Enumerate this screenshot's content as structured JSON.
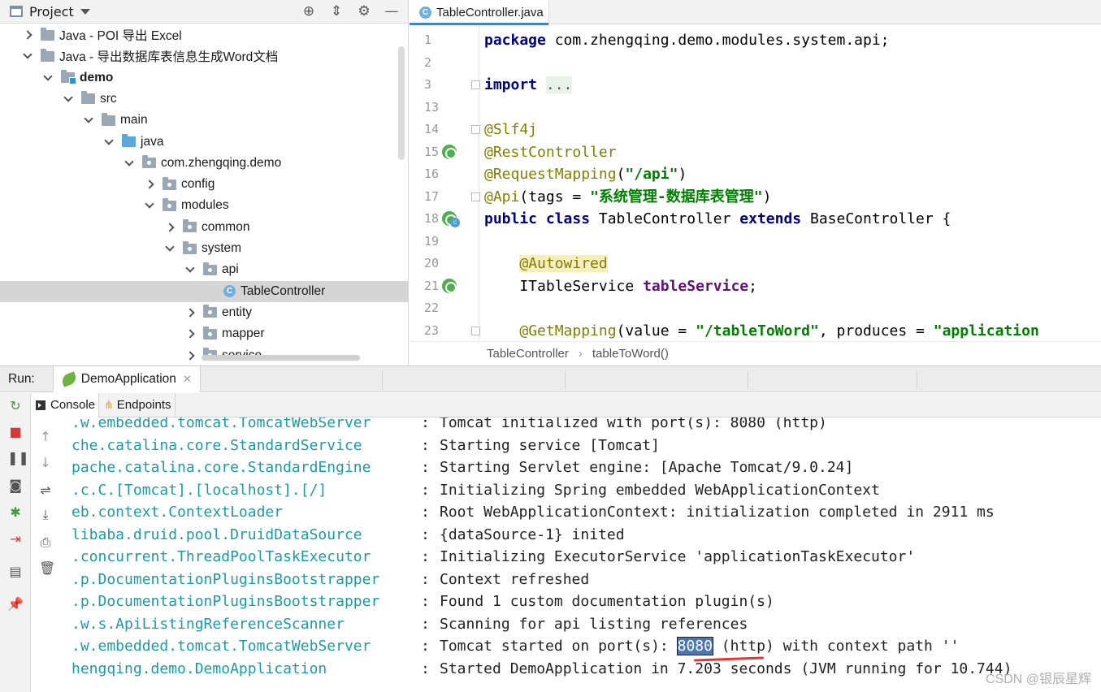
{
  "project": {
    "title": "Project",
    "tree": [
      {
        "label": "Java - POI 导出 Excel",
        "depth": 0,
        "chevron": "right",
        "icon": "folder",
        "bold": false,
        "selected": false
      },
      {
        "label": "Java - 导出数据库表信息生成Word文档",
        "depth": 0,
        "chevron": "down",
        "icon": "folder",
        "bold": false,
        "selected": false
      },
      {
        "label": "demo",
        "depth": 1,
        "chevron": "down",
        "icon": "module-folder",
        "bold": true,
        "selected": false
      },
      {
        "label": "src",
        "depth": 2,
        "chevron": "down",
        "icon": "folder",
        "bold": false,
        "selected": false
      },
      {
        "label": "main",
        "depth": 3,
        "chevron": "down",
        "icon": "folder",
        "bold": false,
        "selected": false
      },
      {
        "label": "java",
        "depth": 4,
        "chevron": "down",
        "icon": "source-folder",
        "bold": false,
        "selected": false
      },
      {
        "label": "com.zhengqing.demo",
        "depth": 5,
        "chevron": "down",
        "icon": "package",
        "bold": false,
        "selected": false
      },
      {
        "label": "config",
        "depth": 6,
        "chevron": "right",
        "icon": "package",
        "bold": false,
        "selected": false
      },
      {
        "label": "modules",
        "depth": 6,
        "chevron": "down",
        "icon": "package",
        "bold": false,
        "selected": false
      },
      {
        "label": "common",
        "depth": 7,
        "chevron": "right",
        "icon": "package",
        "bold": false,
        "selected": false
      },
      {
        "label": "system",
        "depth": 7,
        "chevron": "down",
        "icon": "package",
        "bold": false,
        "selected": false
      },
      {
        "label": "api",
        "depth": 8,
        "chevron": "down",
        "icon": "package",
        "bold": false,
        "selected": false
      },
      {
        "label": "TableController",
        "depth": 9,
        "chevron": "none",
        "icon": "class",
        "bold": false,
        "selected": true
      },
      {
        "label": "entity",
        "depth": 8,
        "chevron": "right",
        "icon": "package",
        "bold": false,
        "selected": false
      },
      {
        "label": "mapper",
        "depth": 8,
        "chevron": "right",
        "icon": "package",
        "bold": false,
        "selected": false
      },
      {
        "label": "service",
        "depth": 8,
        "chevron": "right",
        "icon": "package",
        "bold": false,
        "selected": false
      }
    ]
  },
  "editor": {
    "tab_label": "TableController.java",
    "tab_icon": "class-icon",
    "lines": [
      {
        "num": "1",
        "tokens": [
          [
            "kw",
            "package"
          ],
          [
            "t",
            " com.zhengqing.demo.modules.system.api;"
          ]
        ]
      },
      {
        "num": "2",
        "tokens": []
      },
      {
        "num": "3",
        "tokens": [
          [
            "kw",
            "import"
          ],
          [
            "t",
            " "
          ],
          [
            "fold",
            "..."
          ]
        ]
      },
      {
        "num": "13",
        "tokens": []
      },
      {
        "num": "14",
        "tokens": [
          [
            "ann",
            "@Slf4j"
          ]
        ]
      },
      {
        "num": "15",
        "tokens": [
          [
            "ann",
            "@RestController"
          ]
        ]
      },
      {
        "num": "16",
        "tokens": [
          [
            "ann",
            "@RequestMapping"
          ],
          [
            "t",
            "("
          ],
          [
            "str",
            "\"/api\""
          ],
          [
            "t",
            ")"
          ]
        ]
      },
      {
        "num": "17",
        "tokens": [
          [
            "ann",
            "@Api"
          ],
          [
            "t",
            "(tags = "
          ],
          [
            "str",
            "\"系统管理-数据库表管理\""
          ],
          [
            "t",
            ")"
          ]
        ]
      },
      {
        "num": "18",
        "tokens": [
          [
            "kw",
            "public class"
          ],
          [
            "t",
            " TableController "
          ],
          [
            "kw",
            "extends"
          ],
          [
            "t",
            " BaseController {"
          ]
        ]
      },
      {
        "num": "19",
        "tokens": []
      },
      {
        "num": "20",
        "tokens": [
          [
            "t",
            "    "
          ],
          [
            "annhl",
            "@Autowired"
          ]
        ]
      },
      {
        "num": "21",
        "tokens": [
          [
            "t",
            "    ITableService "
          ],
          [
            "fld",
            "tableService"
          ],
          [
            "t",
            ";"
          ]
        ]
      },
      {
        "num": "22",
        "tokens": []
      },
      {
        "num": "23",
        "tokens": [
          [
            "t",
            "    "
          ],
          [
            "ann",
            "@GetMapping"
          ],
          [
            "t",
            "(value = "
          ],
          [
            "str",
            "\"/tableToWord\""
          ],
          [
            "t",
            ", produces = "
          ],
          [
            "str",
            "\"application"
          ]
        ]
      }
    ],
    "breadcrumb": [
      "TableController",
      "tableToWord()"
    ]
  },
  "run": {
    "label": "Run:",
    "tab_label": "DemoApplication",
    "console_tab": "Console",
    "endpoints_tab": "Endpoints",
    "logs": [
      {
        "logger": ".w.embedded.tomcat.TomcatWebServer",
        "msg": "Tomcat initialized with port(s): 8080 (http)"
      },
      {
        "logger": "che.catalina.core.StandardService",
        "msg": "Starting service [Tomcat]"
      },
      {
        "logger": "pache.catalina.core.StandardEngine",
        "msg": "Starting Servlet engine: [Apache Tomcat/9.0.24]"
      },
      {
        "logger": ".c.C.[Tomcat].[localhost].[/]",
        "msg": "Initializing Spring embedded WebApplicationContext"
      },
      {
        "logger": "eb.context.ContextLoader",
        "msg": "Root WebApplicationContext: initialization completed in 2911 ms"
      },
      {
        "logger": "libaba.druid.pool.DruidDataSource",
        "msg": "{dataSource-1} inited"
      },
      {
        "logger": ".concurrent.ThreadPoolTaskExecutor",
        "msg": "Initializing ExecutorService 'applicationTaskExecutor'"
      },
      {
        "logger": ".p.DocumentationPluginsBootstrapper",
        "msg": "Context refreshed"
      },
      {
        "logger": ".p.DocumentationPluginsBootstrapper",
        "msg": "Found 1 custom documentation plugin(s)"
      },
      {
        "logger": ".w.s.ApiListingReferenceScanner",
        "msg": "Scanning for api listing references"
      },
      {
        "logger": ".w.embedded.tomcat.TomcatWebServer",
        "msg_pre": "Tomcat started on port(s): ",
        "msg_hl": "8080",
        "msg_post": " (http) with context path ''"
      },
      {
        "logger": "hengqing.demo.DemoApplication",
        "msg": "Started DemoApplication in 7.203 seconds (JVM running for 10.744)"
      }
    ],
    "watermark": "CSDN @银辰星辉"
  },
  "colors": {
    "logger": "#1b9ba6",
    "keyword": "#000080",
    "annotation": "#808000",
    "string": "#008000",
    "selection": "#4a78b5",
    "underline": "#e33333"
  }
}
